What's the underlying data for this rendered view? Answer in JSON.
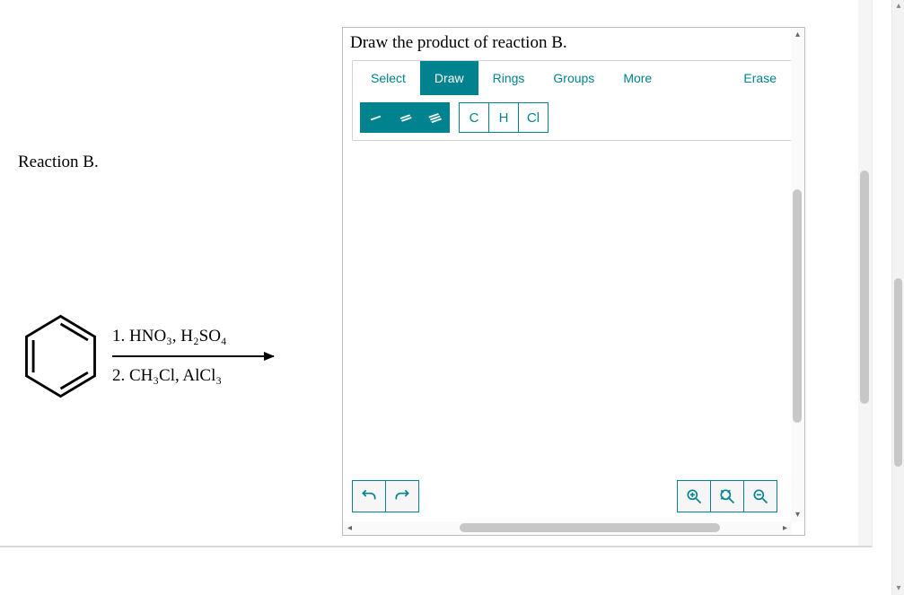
{
  "left": {
    "title": "Reaction B.",
    "reagent1": "1. HNO₃, H₂SO₄",
    "reagent2": "2. CH₃Cl, AlCl₃"
  },
  "editor": {
    "prompt": "Draw the product of reaction B.",
    "tabs": {
      "select": "Select",
      "draw": "Draw",
      "rings": "Rings",
      "groups": "Groups",
      "more": "More",
      "erase": "Erase"
    },
    "atom_buttons": {
      "c": "C",
      "h": "H",
      "cl": "Cl"
    }
  }
}
